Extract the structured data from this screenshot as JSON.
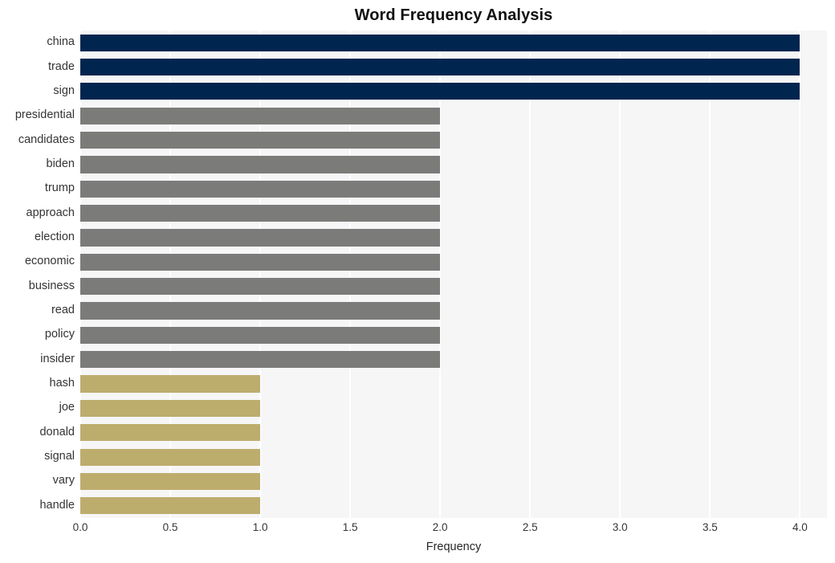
{
  "chart_data": {
    "type": "bar",
    "orientation": "horizontal",
    "title": "Word Frequency Analysis",
    "xlabel": "Frequency",
    "ylabel": "",
    "xlim": [
      0,
      4.15
    ],
    "xticks": [
      "0.0",
      "0.5",
      "1.0",
      "1.5",
      "2.0",
      "2.5",
      "3.0",
      "3.5",
      "4.0"
    ],
    "xtick_values": [
      0.0,
      0.5,
      1.0,
      1.5,
      2.0,
      2.5,
      3.0,
      3.5,
      4.0
    ],
    "grid": "vertical-white-on-light-gray",
    "legend": "none",
    "categories": [
      "china",
      "trade",
      "sign",
      "presidential",
      "candidates",
      "biden",
      "trump",
      "approach",
      "election",
      "economic",
      "business",
      "read",
      "policy",
      "insider",
      "hash",
      "joe",
      "donald",
      "signal",
      "vary",
      "handle"
    ],
    "values": [
      4,
      4,
      4,
      2,
      2,
      2,
      2,
      2,
      2,
      2,
      2,
      2,
      2,
      2,
      1,
      1,
      1,
      1,
      1,
      1
    ],
    "bar_colors": [
      "#00254f",
      "#00254f",
      "#00254f",
      "#7b7b7a",
      "#7b7b7a",
      "#7b7b7a",
      "#7b7b7a",
      "#7b7b7a",
      "#7b7b7a",
      "#7b7b7a",
      "#7b7b7a",
      "#7b7b7a",
      "#7b7b7a",
      "#7b7b7a",
      "#bdad6d",
      "#bdad6d",
      "#bdad6d",
      "#bdad6d",
      "#bdad6d",
      "#bdad6d"
    ],
    "palette": {
      "high": "#00254f",
      "medium": "#7b7b7a",
      "low": "#bdad6d",
      "plot_background": "#f6f6f7",
      "gridline": "#ffffff",
      "figure_background": "#ffffff",
      "text": "#262626"
    }
  }
}
